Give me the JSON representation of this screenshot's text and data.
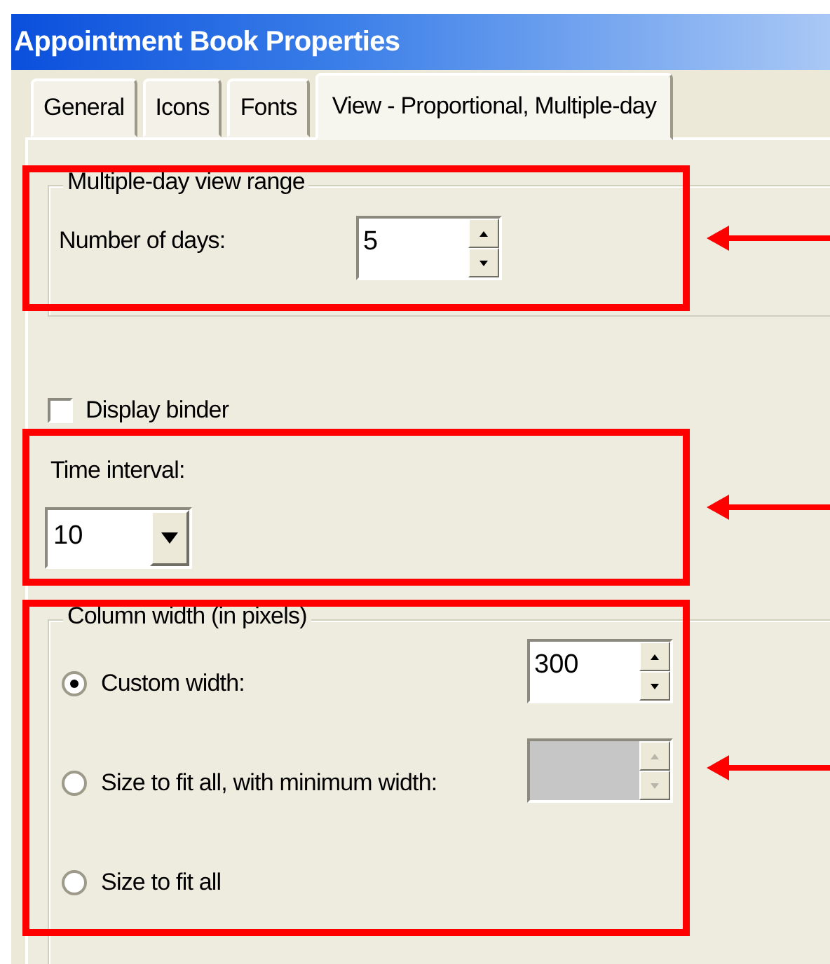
{
  "window": {
    "title": "Appointment Book Properties"
  },
  "tabs": [
    {
      "label": "General",
      "selected": false
    },
    {
      "label": "Icons",
      "selected": false
    },
    {
      "label": "Fonts",
      "selected": false
    },
    {
      "label": "View - Proportional, Multiple-day",
      "selected": true
    }
  ],
  "view_range": {
    "highlighted": true,
    "title": "Multiple-day view range",
    "label": "Number of days:",
    "field": {
      "value": "5",
      "disabled": false
    }
  },
  "display_binder": {
    "label": "Display binder",
    "checked": false
  },
  "time_interval": {
    "highlighted": true,
    "label": "Time interval:",
    "value": "10"
  },
  "column_width": {
    "highlighted": true,
    "title": "Column width (in pixels)",
    "options": [
      {
        "label": "Custom width:",
        "selected": true,
        "field": {
          "value": "300",
          "disabled": false
        }
      },
      {
        "label": "Size to fit all, with minimum width:",
        "selected": false,
        "field": {
          "disabled": true
        }
      },
      {
        "label": "Size to fit all",
        "selected": false
      }
    ]
  }
}
